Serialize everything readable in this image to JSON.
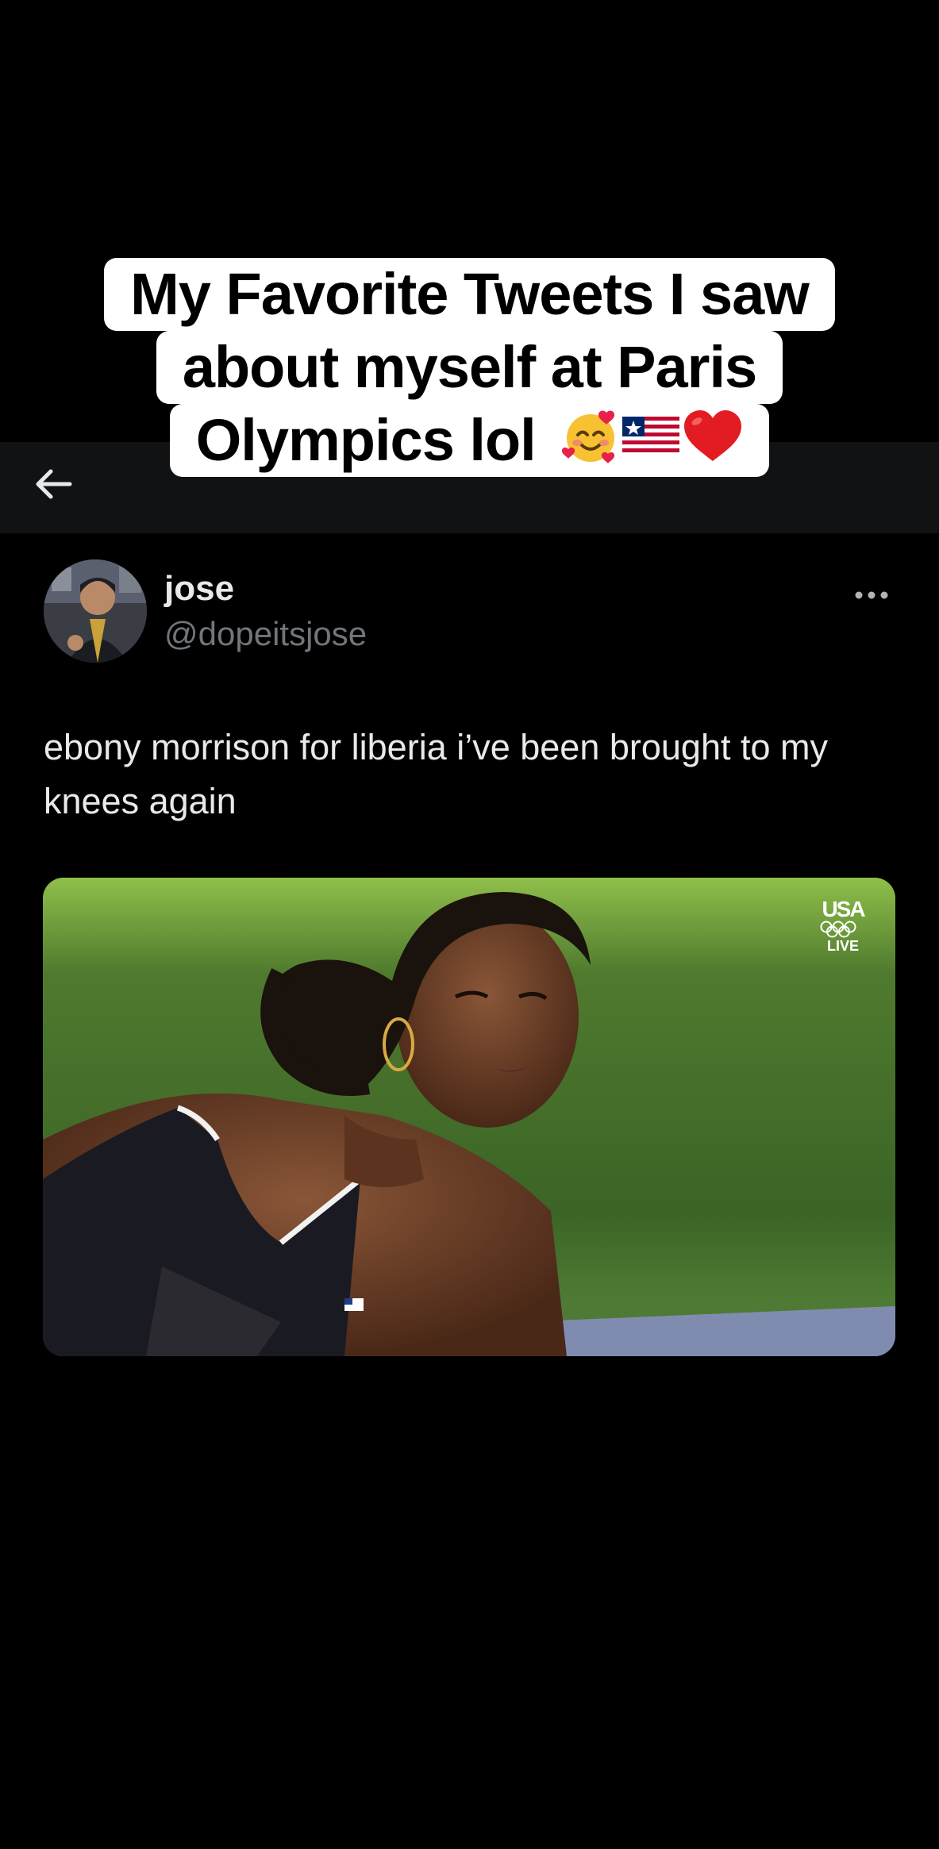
{
  "caption": {
    "line1": "My Favorite Tweets I saw",
    "line2": "about myself at Paris",
    "line3": "Olympics lol",
    "emojis": [
      "smiling-face-with-hearts",
      "liberia-flag",
      "red-heart"
    ]
  },
  "nav": {
    "back_icon": "arrow-left-icon"
  },
  "tweet": {
    "author": {
      "display_name": "jose",
      "handle": "@dopeitsjose"
    },
    "text": "ebony morrison for liberia i’ve been brought to my knees again",
    "media": {
      "broadcaster": "USA",
      "live_label": "LIVE"
    }
  },
  "colors": {
    "background": "#000000",
    "topbar": "#111213",
    "text_primary": "#e7e9ea",
    "text_secondary": "#71767b",
    "caption_bg": "#ffffff"
  }
}
